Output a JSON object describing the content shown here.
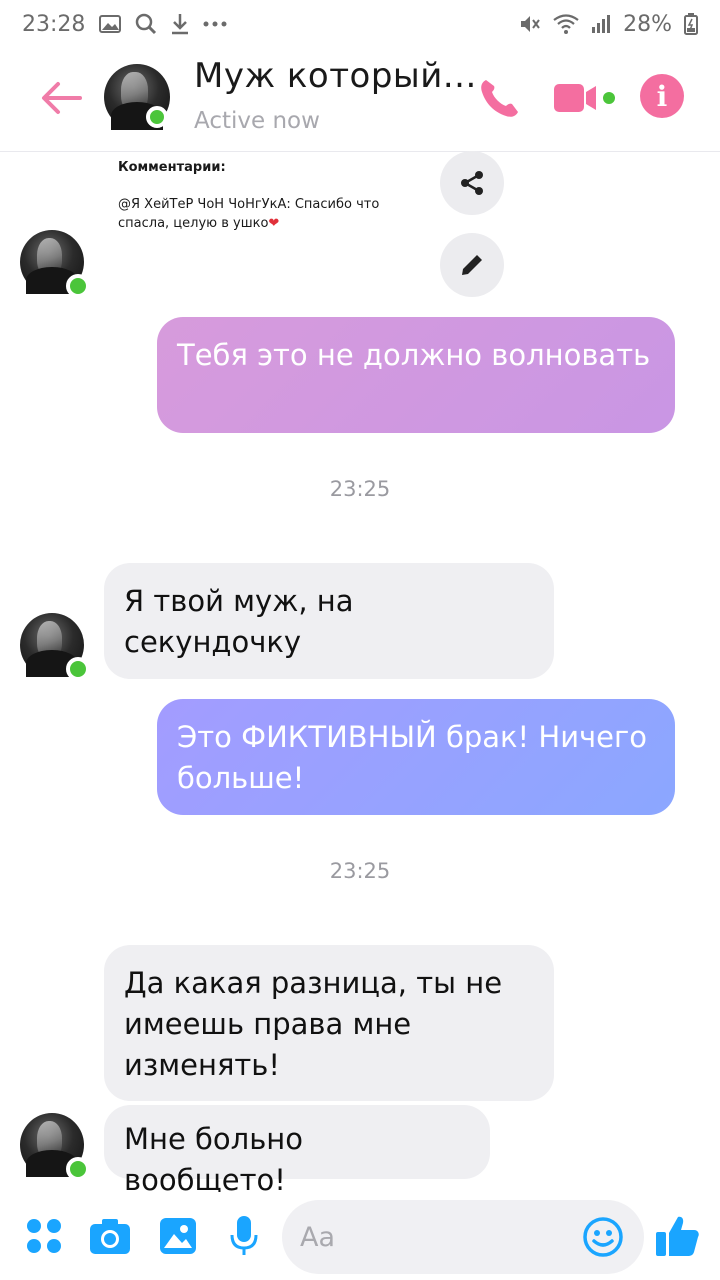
{
  "status_bar": {
    "time": "23:28",
    "battery": "28%",
    "icons": [
      "gallery-icon",
      "search-icon",
      "download-icon",
      "more-dots-icon",
      "mute-icon",
      "wifi-icon",
      "signal-icon",
      "battery-icon"
    ]
  },
  "header": {
    "contact_name": "Муж который...",
    "status": "Active now",
    "accent_color": "#f46ea0",
    "online_color": "#4bc53a"
  },
  "shared_post": {
    "title": "Комментарии:",
    "comment": "@Я ХейТеР ЧоН ЧоНгУкА: Спасибо что спасла, целую в ушко",
    "emoji": "❤"
  },
  "messages": [
    {
      "direction": "out",
      "text": "Тебя это не должно волновать"
    },
    {
      "direction": "in",
      "text": "Я твой муж, на секундочку"
    },
    {
      "direction": "out",
      "text": "Это ФИКТИВНЫЙ брак! Ничего больше!"
    },
    {
      "direction": "in",
      "text": "Да какая разница, ты не имеешь права мне изменять!"
    },
    {
      "direction": "in",
      "text": "Мне больно вообщето!"
    }
  ],
  "timestamps": [
    "23:25",
    "23:25"
  ],
  "composer": {
    "placeholder": "Aa",
    "tool_color": "#1aa5ff"
  }
}
